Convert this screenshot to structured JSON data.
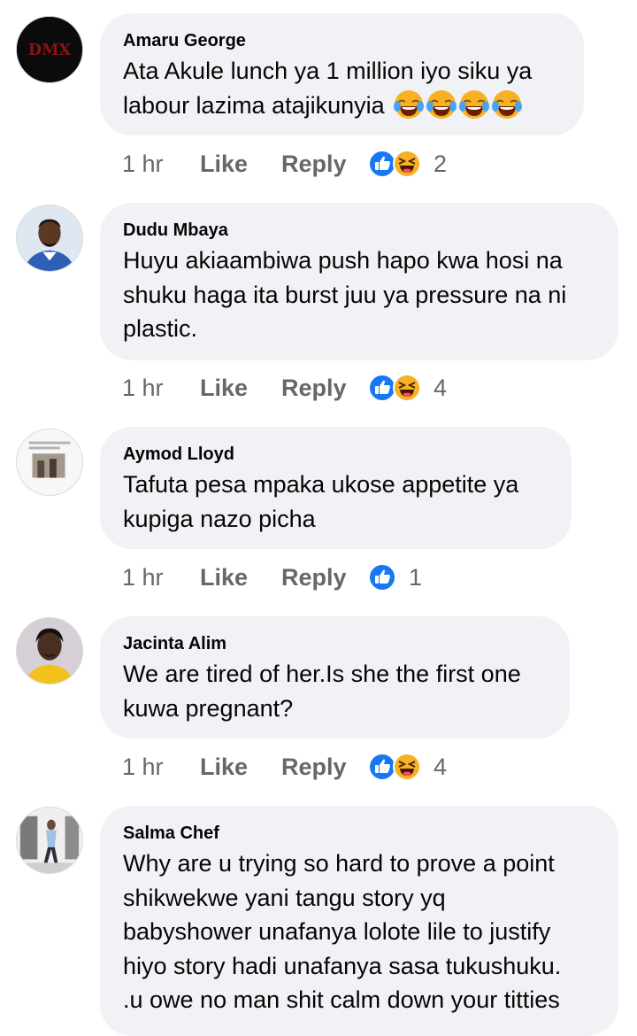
{
  "comments": [
    {
      "author": "Amaru George",
      "lines": [
        "Ata Akule lunch ya 1 million iyo siku ya",
        "labour lazima atajikunyia"
      ],
      "emoji": [
        "joy-emoji",
        "joy-emoji",
        "joy-emoji",
        "joy-emoji"
      ],
      "time": "1 hr",
      "like_label": "Like",
      "reply_label": "Reply",
      "reactions": [
        "like-reaction-icon",
        "haha-reaction-icon"
      ],
      "reaction_count": "2",
      "avatar": "logo-avatar"
    },
    {
      "author": "Dudu Mbaya",
      "lines": [
        "Huyu akiaambiwa push hapo kwa hosi na",
        "shuku haga ita burst juu ya pressure na ni",
        "plastic."
      ],
      "time": "1 hr",
      "like_label": "Like",
      "reply_label": "Reply",
      "reactions": [
        "like-reaction-icon",
        "haha-reaction-icon"
      ],
      "reaction_count": "4",
      "avatar": "man-in-suit-avatar"
    },
    {
      "author": "Aymod Lloyd",
      "lines": [
        "Tafuta pesa mpaka ukose appetite ya",
        "kupiga nazo picha"
      ],
      "time": "1 hr",
      "like_label": "Like",
      "reply_label": "Reply",
      "reactions": [
        "like-reaction-icon"
      ],
      "reaction_count": "1",
      "avatar": "screenshot-avatar"
    },
    {
      "author": "Jacinta Alim",
      "lines": [
        "We are tired of her.Is she the first one",
        "kuwa pregnant?"
      ],
      "time": "1 hr",
      "like_label": "Like",
      "reply_label": "Reply",
      "reactions": [
        "like-reaction-icon",
        "haha-reaction-icon"
      ],
      "reaction_count": "4",
      "avatar": "woman-avatar"
    },
    {
      "author": "Salma Chef",
      "lines": [
        "Why are u trying so hard to prove a point",
        "shikwekwe yani tangu story yq",
        "babyshower unafanya lolote lile to justify",
        "hiyo story hadi unafanya sasa tukushuku.",
        ".u owe no man shit calm down your titties"
      ],
      "avatar": "woman-standing-avatar"
    }
  ],
  "colors": {
    "bubble": "#f0f2f5",
    "secondary_text": "#65676b",
    "like_blue": "#1877f2",
    "haha_yellow": "#f7b125"
  }
}
